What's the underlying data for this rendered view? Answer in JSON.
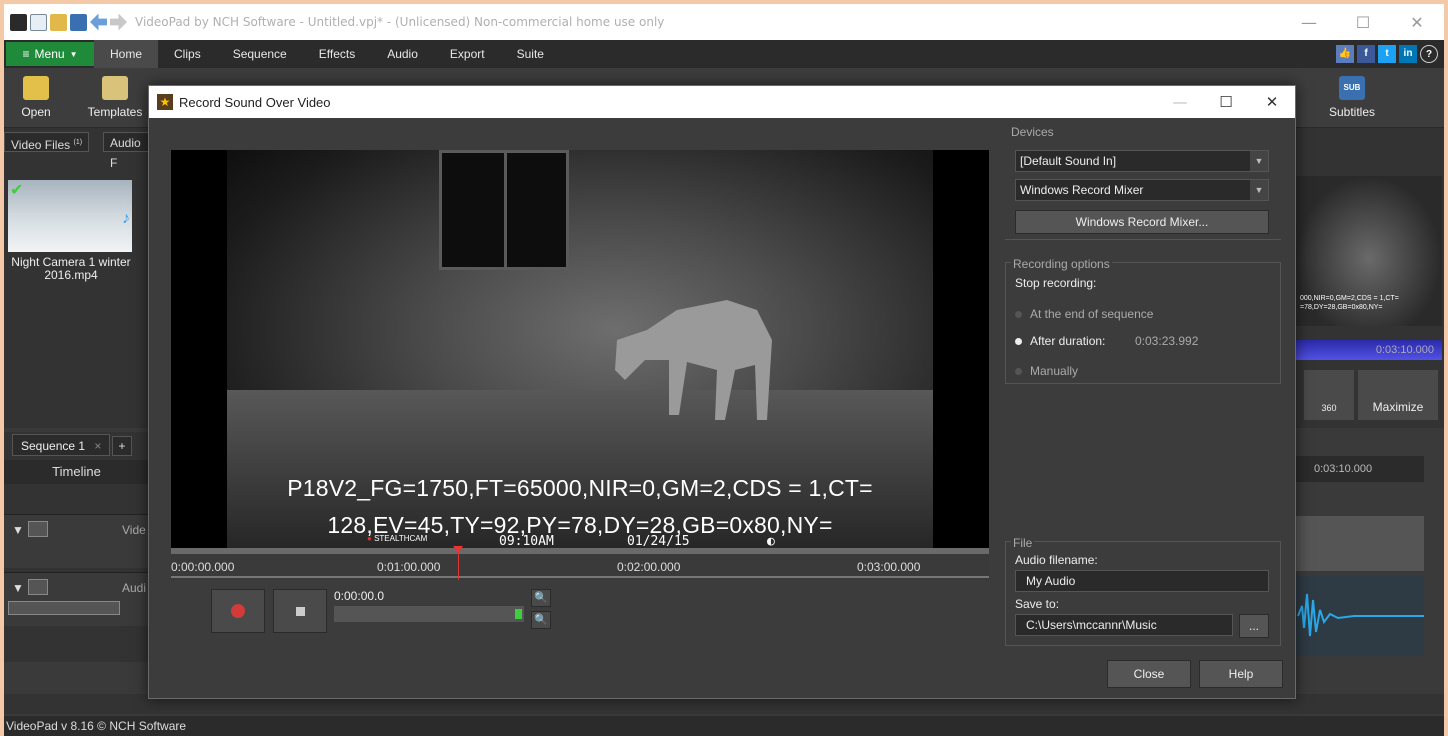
{
  "app": {
    "title": "VideoPad by NCH Software - Untitled.vpj* - (Unlicensed) Non-commercial home use only",
    "menu_label": "Menu",
    "tabs": [
      "Home",
      "Clips",
      "Sequence",
      "Effects",
      "Audio",
      "Export",
      "Suite"
    ],
    "ribbon": {
      "open": "Open",
      "templates": "Templates",
      "subtitles": "Subtitles",
      "sub_badge": "SUB"
    },
    "bins": {
      "video_files": "Video Files",
      "video_files_count": "(1)",
      "audio": "Audio F"
    },
    "clip": {
      "name": "Night Camera 1 winter 2016.mp4"
    },
    "sequence_tab": "Sequence 1",
    "timeline_label": "Timeline",
    "track_video": "Vide",
    "track_audio": "Audi",
    "preview_time": "0:03:10.000",
    "timeline_time": "0:03:10.000",
    "preview_overlay_text": "000,NIR=0,GM=2,CDS = 1,CT= =78,DY=28,GB=0x80,NY=",
    "maximize": "Maximize",
    "btn_360": "360",
    "status": "VideoPad v 8.16 © NCH Software"
  },
  "dialog": {
    "title": "Record Sound Over Video",
    "video": {
      "overlay_line1": "P18V2_FG=1750,FT=65000,NIR=0,GM=2,CDS = 1,CT=",
      "overlay_line2": "128,EV=45,TY=92,PY=78,DY=28,GB=0x80,NY=",
      "brand": "STEALTHCAM",
      "clock": "09:10AM",
      "date": "01/24/15"
    },
    "ruler_ticks": [
      "0:00:00.000",
      "0:01:00.000",
      "0:02:00.000",
      "0:03:00.000"
    ],
    "record_time": "0:00:00.0",
    "devices": {
      "label": "Devices",
      "input": "[Default Sound In]",
      "mixer": "Windows Record Mixer",
      "mixer_button": "Windows Record Mixer..."
    },
    "recording_options": {
      "label": "Recording options",
      "stop_label": "Stop recording:",
      "opt_end": "At the end of sequence",
      "opt_duration": "After duration:",
      "duration_value": "0:03:23.992",
      "opt_manual": "Manually",
      "selected": "After duration:"
    },
    "file": {
      "label": "File",
      "filename_label": "Audio filename:",
      "filename_value": "My Audio",
      "save_label": "Save to:",
      "save_value": "C:\\Users\\mccannr\\Music",
      "browse": "..."
    },
    "close": "Close",
    "help": "Help"
  },
  "colors": {
    "accent_green": "#1f8a3a",
    "record_red": "#d33a3a",
    "timeline_blue": "#3a3ad0"
  }
}
